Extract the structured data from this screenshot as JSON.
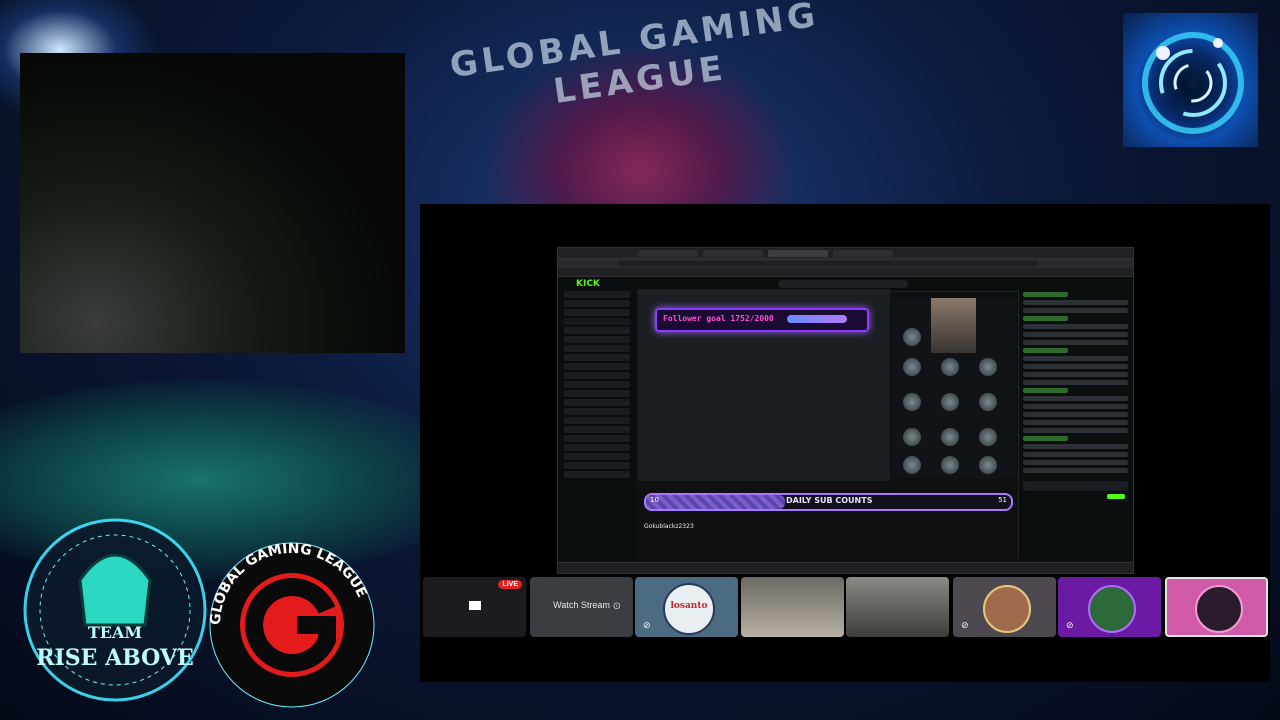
{
  "background": {
    "banner_title": "GLOBAL GAMING LEAGUE",
    "accent": "#2ad1ff"
  },
  "browser": {
    "kick_logo": "KICK",
    "follower_goal": "Follower goal 1752/2000",
    "sub_bar": {
      "label": "DAILY SUB COUNTS",
      "left_count": "10",
      "right_count": "51",
      "progress_fraction": 0.38
    },
    "streamer_name": "Gokublackz2323"
  },
  "call_strip": {
    "live_label": "LIVE",
    "watch_stream_label": "Watch Stream",
    "participant_3_logo_text": "losanto"
  },
  "logos": {
    "team_top": "TEAM",
    "team_bottom": "RISE ABOVE",
    "league_ring": "GLOBAL GAMING LEAGUE"
  },
  "colors": {
    "kick_green": "#53fc18",
    "goal_purple": "#8b3dff",
    "live_red": "#e02424",
    "league_red": "#e41b1b"
  }
}
